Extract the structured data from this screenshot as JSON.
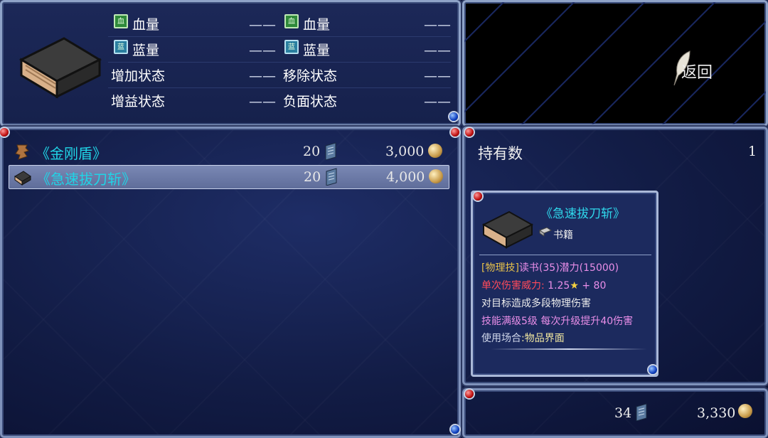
{
  "stats": {
    "rows": [
      {
        "left_label": "血量",
        "left_icon": "血",
        "left_value": "——",
        "right_label": "血量",
        "right_icon": "血",
        "right_value": "——"
      },
      {
        "left_label": "蓝量",
        "left_icon": "蓝",
        "left_value": "——",
        "right_label": "蓝量",
        "right_icon": "蓝",
        "right_value": "——"
      },
      {
        "left_label": "增加状态",
        "left_value": "——",
        "right_label": "移除状态",
        "right_value": "——"
      },
      {
        "left_label": "增益状态",
        "left_value": "——",
        "right_label": "负面状态",
        "right_value": "——"
      }
    ]
  },
  "back": {
    "label": "返回"
  },
  "items": [
    {
      "name": "《金刚盾》",
      "qty": "20",
      "price": "3,000",
      "icon": "scroll-icon",
      "selected": false
    },
    {
      "name": "《急速拔刀斩》",
      "qty": "20",
      "price": "4,000",
      "icon": "book-icon",
      "selected": true
    }
  ],
  "owned": {
    "label": "持有数",
    "value": "1"
  },
  "detail": {
    "title": "《急速拔刀斩》",
    "type": "书籍",
    "line1_a": "[物理技]",
    "line1_b": "读书(35)潜力(15000)",
    "line2_a": "单次伤害威力:",
    "line2_b": "1.25",
    "line2_c": "+ 80",
    "line3": "对目标造成多段物理伤害",
    "line4": "技能满级5级 每次升级提升40伤害",
    "line5_a": "使用场合",
    "line5_b": ":物品界面"
  },
  "footer": {
    "books": "34",
    "gold": "3,330"
  },
  "colors": {
    "item_name": "#20d4e6",
    "gold_text": "#e6c04a",
    "pink_text": "#e98ee8",
    "red_text": "#ff4a5a"
  }
}
